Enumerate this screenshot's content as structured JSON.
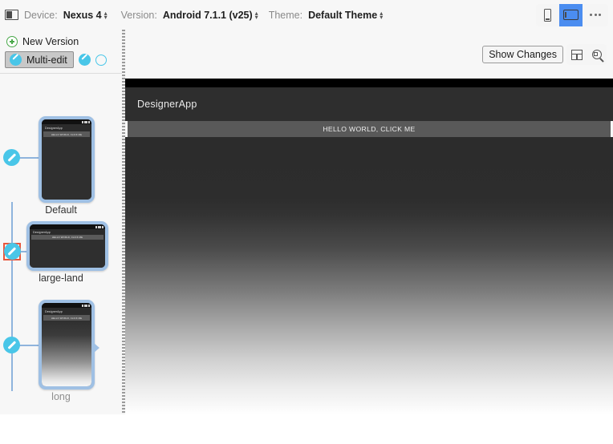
{
  "toolbar": {
    "device_icon": "monitor-icon",
    "device_label": "Device:",
    "device_value": "Nexus 4",
    "version_label": "Version:",
    "version_value": "Android 7.1.1 (v25)",
    "theme_label": "Theme:",
    "theme_value": "Default Theme",
    "orientation_portrait_icon": "phone-portrait-icon",
    "orientation_landscape_icon": "phone-landscape-icon",
    "overflow_icon": "more-options-icon",
    "selected_orientation": "landscape",
    "accent_blue": "#4b8df0"
  },
  "sidebar": {
    "new_version_label": "New Version",
    "new_version_icon": "plus-circle-icon",
    "multi_edit_label": "Multi-edit",
    "multi_edit_icon": "pencil-circle-icon",
    "edit_icon": "pencil-circle-icon",
    "empty_circle_icon": "circle-outline-icon",
    "tree": {
      "selected_node": "large-land",
      "selection_color": "#e8563c",
      "connector_color": "#8fb4dd",
      "nodes": [
        {
          "label": "Default",
          "orientation": "portrait",
          "gradient": false,
          "selected": false
        },
        {
          "label": "large-land",
          "orientation": "landscape",
          "gradient": false,
          "selected": true
        },
        {
          "label": "long",
          "orientation": "portrait",
          "gradient": true,
          "selected": false
        }
      ],
      "preview": {
        "app_title": "DesignerApp",
        "button_text": "HELLO WORLD, CLICK ME"
      }
    }
  },
  "main": {
    "show_changes_label": "Show Changes",
    "layout_icon": "split-layout-icon",
    "zoom_icon": "zoom-magnifier-icon",
    "device_view": {
      "app_title": "DesignerApp",
      "button_text": "HELLO WORLD, CLICK ME"
    }
  }
}
